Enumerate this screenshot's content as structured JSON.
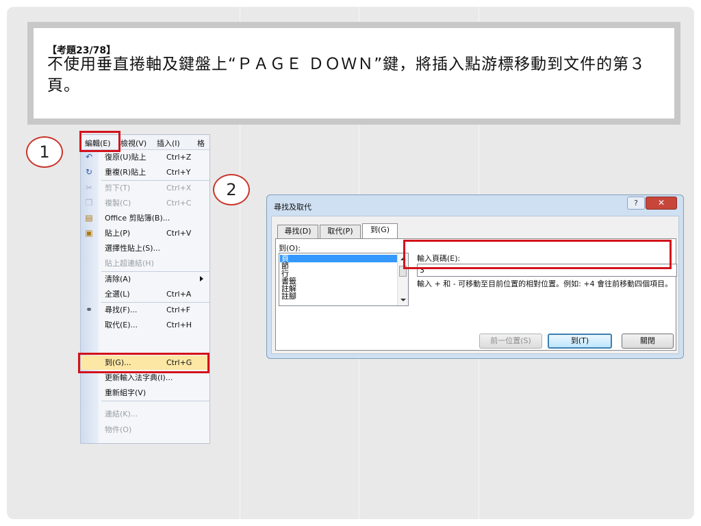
{
  "question": {
    "title": "【考題23/78】",
    "text": "不使用垂直捲軸及鍵盤上“ＰＡＧＥ ＤＯＷＮ”鍵，將插入點游標移動到文件的第３頁。"
  },
  "steps": [
    "1",
    "2"
  ],
  "menu_bar": [
    "編輯(E)",
    "檢視(V)",
    "插入(I)",
    "格"
  ],
  "menu_items": [
    {
      "label": "復原(U)貼上",
      "shortcut": "Ctrl+Z",
      "icon": "undo-icon"
    },
    {
      "label": "重複(R)貼上",
      "shortcut": "Ctrl+Y",
      "icon": "redo-icon"
    },
    {
      "label": "剪下(T)",
      "shortcut": "Ctrl+X",
      "icon": "cut-icon"
    },
    {
      "label": "複製(C)",
      "shortcut": "Ctrl+C",
      "icon": "copy-icon"
    },
    {
      "label": "Office 剪貼簿(B)...",
      "shortcut": "",
      "icon": "clipboard-icon"
    },
    {
      "label": "貼上(P)",
      "shortcut": "Ctrl+V",
      "icon": "paste-icon"
    },
    {
      "label": "選擇性貼上(S)...",
      "shortcut": "",
      "icon": ""
    },
    {
      "label": "貼上超連結(H)",
      "shortcut": "",
      "icon": ""
    },
    {
      "label": "清除(A)",
      "shortcut": "",
      "icon": ""
    },
    {
      "label": "全選(L)",
      "shortcut": "Ctrl+A",
      "icon": ""
    },
    {
      "label": "尋找(F)...",
      "shortcut": "Ctrl+F",
      "icon": "binoculars-icon"
    },
    {
      "label": "取代(E)...",
      "shortcut": "Ctrl+H",
      "icon": ""
    },
    {
      "label": "到(G)...",
      "shortcut": "Ctrl+G",
      "icon": ""
    },
    {
      "label": "更新輸入法字典(I)...",
      "shortcut": "",
      "icon": ""
    },
    {
      "label": "重新組字(V)",
      "shortcut": "",
      "icon": ""
    },
    {
      "label": "連結(K)...",
      "shortcut": "",
      "icon": ""
    },
    {
      "label": "物件(O)",
      "shortcut": "",
      "icon": ""
    }
  ],
  "dialog": {
    "title": "尋找及取代",
    "help": "?",
    "close": "✕",
    "tabs": [
      "尋找(D)",
      "取代(P)",
      "到(G)"
    ],
    "goto_label": "到(O):",
    "goto_items": [
      "頁",
      "節",
      "行",
      "書籤",
      "註解",
      "註腳"
    ],
    "page_label": "輸入頁碼(E):",
    "page_value": "3",
    "hint": "輸入 + 和 - 可移動至目前位置的相對位置。例如: +4 會往前移動四個項目。",
    "btn_prev": "前一位置(S)",
    "btn_goto": "到(T)",
    "btn_close": "關閉"
  },
  "colors": {
    "highlight": "#d3121b",
    "selection": "#3399ff"
  }
}
